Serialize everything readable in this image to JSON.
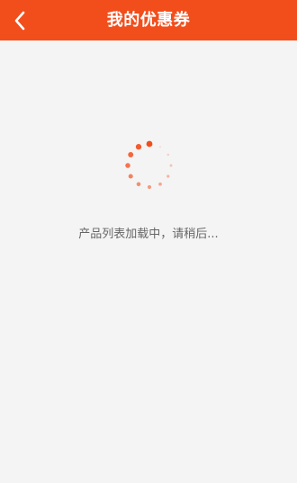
{
  "header": {
    "title": "我的优惠券",
    "back_icon": "chevron-left-icon"
  },
  "main": {
    "loading_text": "产品列表加载中，请稍后..."
  },
  "colors": {
    "accent": "#f24e1c",
    "background": "#f4f4f4"
  }
}
